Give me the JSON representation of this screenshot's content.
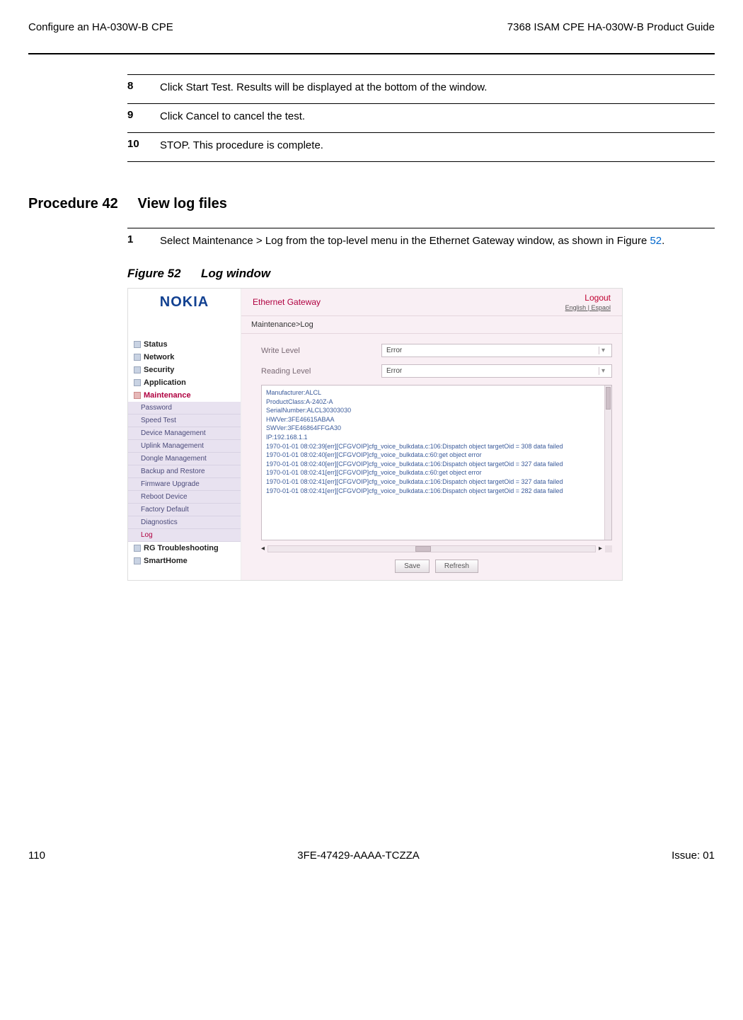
{
  "header": {
    "left": "Configure an HA-030W-B CPE",
    "right": "7368 ISAM CPE HA-030W-B Product Guide"
  },
  "steps": [
    {
      "num": "8",
      "text": "Click Start Test. Results will be displayed at the bottom of the window."
    },
    {
      "num": "9",
      "text": "Click Cancel to cancel the test."
    },
    {
      "num": "10",
      "text": "STOP. This procedure is complete."
    }
  ],
  "procedure": {
    "label": "Procedure 42",
    "title": "View log files"
  },
  "proc_step": {
    "num": "1",
    "text_before": "Select Maintenance > Log from the top-level menu in the Ethernet Gateway window, as shown in Figure ",
    "link": "52",
    "text_after": "."
  },
  "figure": {
    "label": "Figure 52",
    "title": "Log window"
  },
  "screenshot": {
    "logo": "NOKIA",
    "header_title": "Ethernet Gateway",
    "logout": "Logout",
    "lang": "English | Espaol",
    "breadcrumb": "Maintenance>Log",
    "nav": {
      "top": [
        {
          "label": "Status",
          "active": false
        },
        {
          "label": "Network",
          "active": false
        },
        {
          "label": "Security",
          "active": false
        },
        {
          "label": "Application",
          "active": false
        },
        {
          "label": "Maintenance",
          "active": true
        }
      ],
      "sub": [
        {
          "label": "Password",
          "active": false
        },
        {
          "label": "Speed Test",
          "active": false
        },
        {
          "label": "Device Management",
          "active": false
        },
        {
          "label": "Uplink Management",
          "active": false
        },
        {
          "label": "Dongle Management",
          "active": false
        },
        {
          "label": "Backup and Restore",
          "active": false
        },
        {
          "label": "Firmware Upgrade",
          "active": false
        },
        {
          "label": "Reboot Device",
          "active": false
        },
        {
          "label": "Factory Default",
          "active": false
        },
        {
          "label": "Diagnostics",
          "active": false
        },
        {
          "label": "Log",
          "active": true
        }
      ],
      "bottom": [
        {
          "label": "RG Troubleshooting"
        },
        {
          "label": "SmartHome"
        }
      ]
    },
    "fields": {
      "write_level_label": "Write Level",
      "write_level_value": "Error",
      "reading_level_label": "Reading Level",
      "reading_level_value": "Error"
    },
    "log_lines": [
      "Manufacturer:ALCL",
      "ProductClass:A-240Z-A",
      "SerialNumber:ALCL30303030",
      "HWVer:3FE46615ABAA",
      "SWVer:3FE46864FFGA30",
      "IP:192.168.1.1",
      "",
      "1970-01-01 08:02:39[err][CFGVOIP]cfg_voice_bulkdata.c:106:Dispatch object targetOid = 308 data failed",
      "1970-01-01 08:02:40[err][CFGVOIP]cfg_voice_bulkdata.c:60:get object error",
      "1970-01-01 08:02:40[err][CFGVOIP]cfg_voice_bulkdata.c:106:Dispatch object targetOid = 327 data failed",
      "1970-01-01 08:02:41[err][CFGVOIP]cfg_voice_bulkdata.c:60:get object error",
      "1970-01-01 08:02:41[err][CFGVOIP]cfg_voice_bulkdata.c:106:Dispatch object targetOid = 327 data failed",
      "1970-01-01 08:02:41[err][CFGVOIP]cfg_voice_bulkdata.c:106:Dispatch object targetOid = 282 data failed"
    ],
    "buttons": {
      "save": "Save",
      "refresh": "Refresh"
    }
  },
  "footer": {
    "left": "110",
    "center": "3FE-47429-AAAA-TCZZA",
    "right": "Issue: 01"
  }
}
